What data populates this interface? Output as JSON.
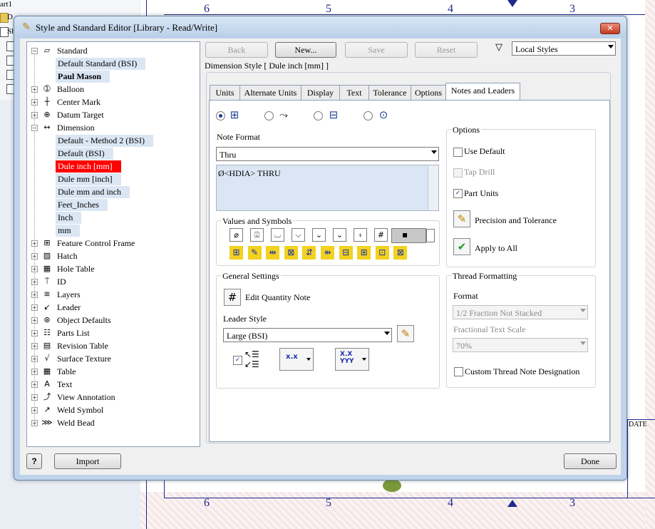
{
  "background": {
    "left_tree_items": [
      "art1",
      "D",
      "Sh",
      "",
      "",
      "",
      ""
    ],
    "zone_numbers_top": [
      "6",
      "5",
      "4",
      "3"
    ],
    "zone_numbers_bottom": [
      "6",
      "5",
      "4",
      "3"
    ],
    "date_label": "DATE"
  },
  "dialog": {
    "title": "Style and Standard Editor [Library - Read/Write]",
    "close_glyph": "✕"
  },
  "tree": [
    {
      "label": "Standard",
      "icon": "standard-icon",
      "glyph": "▱",
      "level": 0,
      "expander": "−"
    },
    {
      "label": "Default Standard (BSI)",
      "level": 1,
      "state": "selected"
    },
    {
      "label": "Paul Mason",
      "level": 1,
      "state": "bold-selected"
    },
    {
      "label": "Balloon",
      "icon": "balloon-icon",
      "glyph": "➀",
      "level": 0,
      "expander": "+"
    },
    {
      "label": "Center Mark",
      "icon": "center-mark-icon",
      "glyph": "┼",
      "level": 0,
      "expander": "+"
    },
    {
      "label": "Datum Target",
      "icon": "datum-target-icon",
      "glyph": "⊕",
      "level": 0,
      "expander": "+"
    },
    {
      "label": "Dimension",
      "icon": "dimension-icon",
      "glyph": "↔",
      "level": 0,
      "expander": "−"
    },
    {
      "label": "Default - Method 2 (BSI)",
      "level": 1,
      "state": "selected"
    },
    {
      "label": "Default (BSI)",
      "level": 1,
      "state": "selected"
    },
    {
      "label": "Dule inch [mm]",
      "level": 1,
      "state": "active"
    },
    {
      "label": "Dule mm [inch]",
      "level": 1,
      "state": "selected"
    },
    {
      "label": "Dule mm and inch",
      "level": 1,
      "state": "selected"
    },
    {
      "label": "Feet_Inches",
      "level": 1,
      "state": "selected"
    },
    {
      "label": "Inch",
      "level": 1,
      "state": "selected"
    },
    {
      "label": "mm",
      "level": 1,
      "state": "selected"
    },
    {
      "label": "Feature Control Frame",
      "icon": "feature-control-frame-icon",
      "glyph": "⊞",
      "level": 0,
      "expander": "+"
    },
    {
      "label": "Hatch",
      "icon": "hatch-icon",
      "glyph": "▨",
      "level": 0,
      "expander": "+"
    },
    {
      "label": "Hole Table",
      "icon": "hole-table-icon",
      "glyph": "▦",
      "level": 0,
      "expander": "+"
    },
    {
      "label": "ID",
      "icon": "id-icon",
      "glyph": "⍑",
      "level": 0,
      "expander": "+"
    },
    {
      "label": "Layers",
      "icon": "layers-icon",
      "glyph": "≋",
      "level": 0,
      "expander": "+"
    },
    {
      "label": "Leader",
      "icon": "leader-icon",
      "glyph": "↙",
      "level": 0,
      "expander": "+"
    },
    {
      "label": "Object Defaults",
      "icon": "object-defaults-icon",
      "glyph": "⊛",
      "level": 0,
      "expander": "+"
    },
    {
      "label": "Parts List",
      "icon": "parts-list-icon",
      "glyph": "☷",
      "level": 0,
      "expander": "+"
    },
    {
      "label": "Revision Table",
      "icon": "revision-table-icon",
      "glyph": "▤",
      "level": 0,
      "expander": "+"
    },
    {
      "label": "Surface Texture",
      "icon": "surface-texture-icon",
      "glyph": "√",
      "level": 0,
      "expander": "+"
    },
    {
      "label": "Table",
      "icon": "table-icon",
      "glyph": "▦",
      "level": 0,
      "expander": "+"
    },
    {
      "label": "Text",
      "icon": "text-icon",
      "glyph": "A",
      "level": 0,
      "expander": "+"
    },
    {
      "label": "View Annotation",
      "icon": "view-annotation-icon",
      "glyph": "⤴",
      "level": 0,
      "expander": "+"
    },
    {
      "label": "Weld Symbol",
      "icon": "weld-symbol-icon",
      "glyph": "↗",
      "level": 0,
      "expander": "+"
    },
    {
      "label": "Weld Bead",
      "icon": "weld-bead-icon",
      "glyph": "⋙",
      "level": 0,
      "expander": "+"
    }
  ],
  "toolbar": {
    "back": "Back",
    "new": "New...",
    "save": "Save",
    "reset": "Reset",
    "filter_glyph": "▽",
    "style_filter": "Local Styles"
  },
  "panel": {
    "heading": "Dimension Style [ Dule inch [mm] ]",
    "tabs": [
      "Units",
      "Alternate Units",
      "Display",
      "Text",
      "Tolerance",
      "Options",
      "Notes and Leaders"
    ],
    "active_tab": "Notes and Leaders"
  },
  "note_format": {
    "label": "Note Format",
    "selected": "Thru",
    "text": "Ø<HDIA> THRU",
    "radio_glyphs": [
      "⊞",
      "⤳",
      "⊟",
      "⊙"
    ]
  },
  "values_symbols": {
    "label": "Values and Symbols",
    "row1": [
      "⌀",
      "⍗",
      "⌴",
      "⌵",
      "⌄",
      "⌄",
      "⍖",
      "#"
    ],
    "color_glyph": "▪",
    "row2": [
      "⊞",
      "✎",
      "⇹",
      "⊠",
      "⇵",
      "⇻",
      "⊟",
      "⊞",
      "⊡",
      "⊠"
    ]
  },
  "general_settings": {
    "label": "General Settings",
    "edit_quantity": "Edit Quantity Note",
    "edit_glyph": "#",
    "leader_style_label": "Leader Style",
    "leader_style": "Large (BSI)",
    "pencil_glyph": "✎",
    "btn1_text": "x.x",
    "btn2_text": "X.X YYY"
  },
  "options": {
    "label": "Options",
    "use_default": "Use Default",
    "tap_drill": "Tap Drill",
    "part_units": "Part Units",
    "part_units_checked": "✓",
    "precision": "Precision and Tolerance",
    "apply_all": "Apply to All",
    "precision_glyph": "✎",
    "apply_glyph": "✔"
  },
  "thread": {
    "label": "Thread Formatting",
    "format_label": "Format",
    "format_value": "1/2 Fraction Not Stacked",
    "scale_label": "Fractional Text Scale",
    "scale_value": "70%",
    "custom_label": "Custom Thread Note Designation"
  },
  "footer": {
    "help": "?",
    "import": "Import",
    "done": "Done"
  },
  "colors": {
    "accent": "#1a3b8f",
    "active_tree_bg": "#ff0000",
    "selected_tree_bg": "#dbe6f4",
    "drawing_lines": "#1f2a8c"
  }
}
